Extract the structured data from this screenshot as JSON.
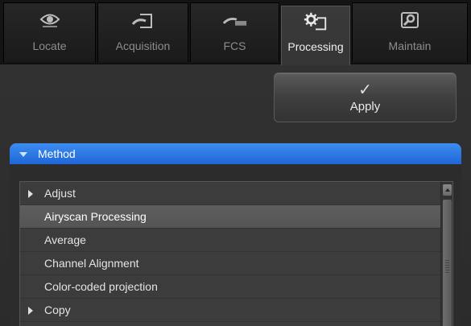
{
  "tabs": [
    {
      "label": "Locate",
      "icon": "eye-icon",
      "active": false
    },
    {
      "label": "Acquisition",
      "icon": "acquisition-icon",
      "active": false
    },
    {
      "label": "FCS",
      "icon": "fcs-icon",
      "active": false
    },
    {
      "label": "Processing",
      "icon": "gear-icon",
      "active": true
    },
    {
      "label": "Maintain",
      "icon": "wrench-icon",
      "active": false
    }
  ],
  "apply": {
    "label": "Apply",
    "icon": "checkmark-icon",
    "check_glyph": "✓"
  },
  "method": {
    "title": "Method",
    "items": [
      {
        "label": "Adjust",
        "expandable": true,
        "selected": false
      },
      {
        "label": "Airyscan Processing",
        "expandable": false,
        "selected": true
      },
      {
        "label": "Average",
        "expandable": false,
        "selected": false
      },
      {
        "label": "Channel Alignment",
        "expandable": false,
        "selected": false
      },
      {
        "label": "Color-coded projection",
        "expandable": false,
        "selected": false
      },
      {
        "label": "Copy",
        "expandable": true,
        "selected": false
      }
    ]
  },
  "colors": {
    "accent": "#2a78e4",
    "panel_bg": "#2b2b2b",
    "selected_row": "#5a5a5a",
    "active_tab": "#383838"
  }
}
